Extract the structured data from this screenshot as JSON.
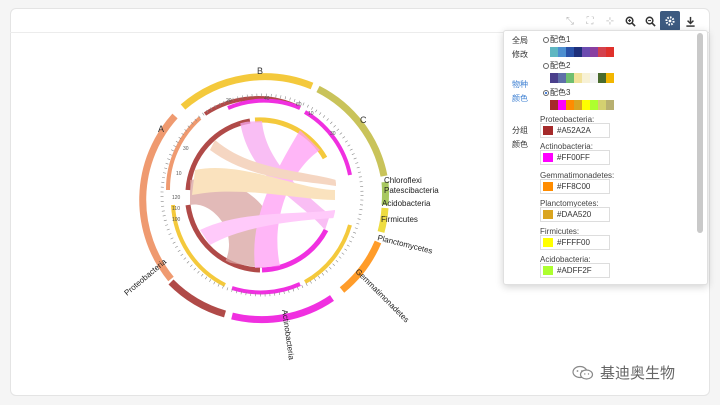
{
  "toolbar": {
    "buttons": [
      "restore-icon",
      "zoom-fit-icon",
      "shrink-icon",
      "zoom-in-icon",
      "zoom-out-icon",
      "settings-icon",
      "download-icon"
    ]
  },
  "settings": {
    "global_label": "全局修改",
    "species_color_label": "物种颜色",
    "group_color_label": "分组颜色",
    "schemes": [
      {
        "label": "配色1",
        "selected": false,
        "colors": [
          "#5fb7c2",
          "#4d8fd0",
          "#2a52a8",
          "#1e2f7a",
          "#6b4bb0",
          "#8a3fa0",
          "#d4414d",
          "#e0312b"
        ]
      },
      {
        "label": "配色2",
        "selected": false,
        "colors": [
          "#4a3f8c",
          "#5e6fa8",
          "#6fbe6f",
          "#f2e29a",
          "#f7f1d5",
          "#f3f3f3",
          "#4a6b2d",
          "#f2b600"
        ]
      },
      {
        "label": "配色3",
        "selected": true,
        "colors": [
          "#a52a2a",
          "#ff00ff",
          "#ff8c00",
          "#daa520",
          "#ffff00",
          "#adff2f",
          "#d4d070",
          "#b8b070"
        ]
      }
    ],
    "groups": [
      {
        "name": "Proteobacteria:",
        "hex": "#A52A2A"
      },
      {
        "name": "Actinobacteria:",
        "hex": "#FF00FF"
      },
      {
        "name": "Gemmatimonadetes:",
        "hex": "#FF8C00"
      },
      {
        "name": "Planctomycetes:",
        "hex": "#DAA520"
      },
      {
        "name": "Firmicutes:",
        "hex": "#FFFF00"
      },
      {
        "name": "Acidobacteria:",
        "hex": "#ADFF2F"
      }
    ]
  },
  "chord": {
    "group_labels": [
      "A",
      "B",
      "C"
    ],
    "species_labels": [
      "Chloroflexi",
      "Patescibacteria",
      "Acidobacteria",
      "Firmicutes",
      "Planctomycetes",
      "Gemmatimonadetes",
      "Actinobacteria",
      "Proteobacteria"
    ]
  },
  "watermark": "基迪奥生物"
}
